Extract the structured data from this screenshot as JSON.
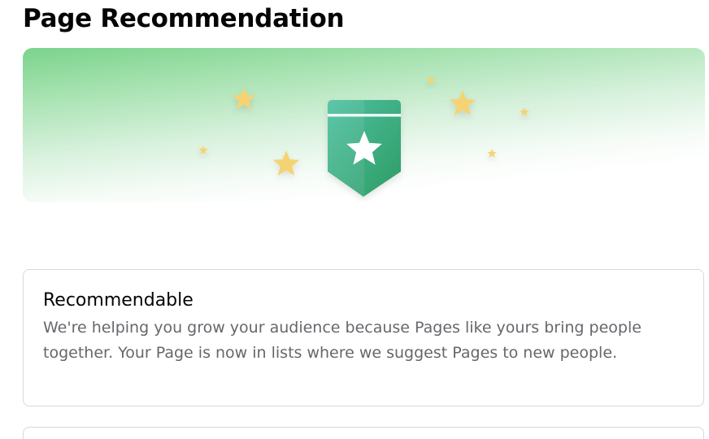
{
  "page": {
    "title": "Page Recommendation"
  },
  "banner": {
    "icon": "recommendation-badge-star-icon",
    "decorations": "sparkle-stars",
    "colors": {
      "gradient_top": "#7bd38c",
      "badge_light": "#4fc1a3",
      "badge_dark": "#2e9c64",
      "star": "#f5d374"
    }
  },
  "status_card": {
    "title": "Recommendable",
    "description": "We're helping you grow your audience because Pages like yours bring people together. Your Page is now in lists where we suggest Pages to new people."
  },
  "colors": {
    "title_text": "#050505",
    "secondary_text": "#65676b",
    "card_border": "#d7d8db"
  }
}
